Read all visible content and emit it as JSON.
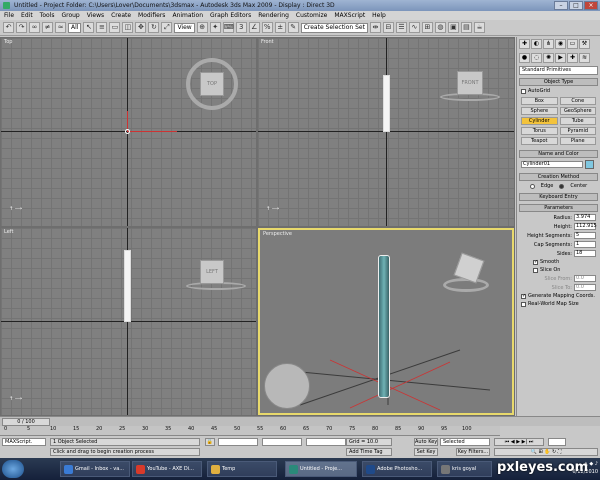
{
  "window": {
    "title": "Untitled    - Project Folder: C:\\Users\\Lover\\Documents\\3dsmax    - Autodesk 3ds Max  2009          - Display : Direct 3D"
  },
  "menu": [
    "File",
    "Edit",
    "Tools",
    "Group",
    "Views",
    "Create",
    "Modifiers",
    "Animation",
    "Graph Editors",
    "Rendering",
    "Customize",
    "MAXScript",
    "Help"
  ],
  "toolbar": {
    "filter_select": "All",
    "ref_coord_select": "View",
    "selection_set": "Create Selection Set"
  },
  "viewports": {
    "top": {
      "label": "Top",
      "cube": "TOP"
    },
    "front": {
      "label": "Front",
      "cube": "FRONT"
    },
    "left": {
      "label": "Left",
      "cube": "LEFT"
    },
    "perspective": {
      "label": "Perspective"
    }
  },
  "command_panel": {
    "category_select": "Standard Primitives",
    "object_type_title": "Object Type",
    "autogrid_label": "AutoGrid",
    "primitives": [
      "Box",
      "Cone",
      "Sphere",
      "GeoSphere",
      "Cylinder",
      "Tube",
      "Torus",
      "Pyramid",
      "Teapot",
      "Plane"
    ],
    "active_primitive": "Cylinder",
    "name_color_title": "Name and Color",
    "object_name": "Cylinder01",
    "color_swatch": "#7fc7e0",
    "creation_method_title": "Creation Method",
    "edge_label": "Edge",
    "center_label": "Center",
    "keyboard_entry_title": "Keyboard Entry",
    "parameters_title": "Parameters",
    "radius_label": "Radius:",
    "radius_value": "3.974",
    "height_label": "Height:",
    "height_value": "112.915",
    "height_segments_label": "Height Segments:",
    "height_segments_value": "5",
    "cap_segments_label": "Cap Segments:",
    "cap_segments_value": "1",
    "sides_label": "Sides:",
    "sides_value": "18",
    "smooth_label": "Smooth",
    "slice_on_label": "Slice On",
    "slice_from_label": "Slice From:",
    "slice_from_value": "0.0",
    "slice_to_label": "Slice To:",
    "slice_to_value": "0.0",
    "gen_mapping_label": "Generate Mapping Coords.",
    "realworld_label": "Real-World Map Size"
  },
  "timeline": {
    "frame_counter": "0 / 100",
    "ticks": [
      "0",
      "5",
      "10",
      "15",
      "20",
      "25",
      "30",
      "35",
      "40",
      "45",
      "50",
      "55",
      "60",
      "65",
      "70",
      "75",
      "80",
      "85",
      "90",
      "95",
      "100"
    ]
  },
  "status": {
    "maxscript": "MAXScript.",
    "selected": "1 Object Selected",
    "prompt": "Click and drag to begin creation process",
    "grid": "Grid = 10.0",
    "add_time_tag": "Add Time Tag",
    "auto_key": "Auto Key",
    "selected_select": "Selected",
    "set_key": "Set Key",
    "key_filters": "Key Filters..."
  },
  "taskbar": {
    "items": [
      {
        "label": "Gmail - Inbox - va...",
        "color": "#3a7bd5"
      },
      {
        "label": "YouTube - AXE Di...",
        "color": "#d83a2a"
      },
      {
        "label": "Temp",
        "color": "#e0b040"
      },
      {
        "label": "Untitled    - Proje...",
        "color": "#2a8a7a"
      },
      {
        "label": "Adobe Photosho...",
        "color": "#1f4a8a"
      },
      {
        "label": "kris goyal",
        "color": "#777777"
      }
    ],
    "date": "6/12/2010"
  },
  "watermark": "pxleyes.com"
}
